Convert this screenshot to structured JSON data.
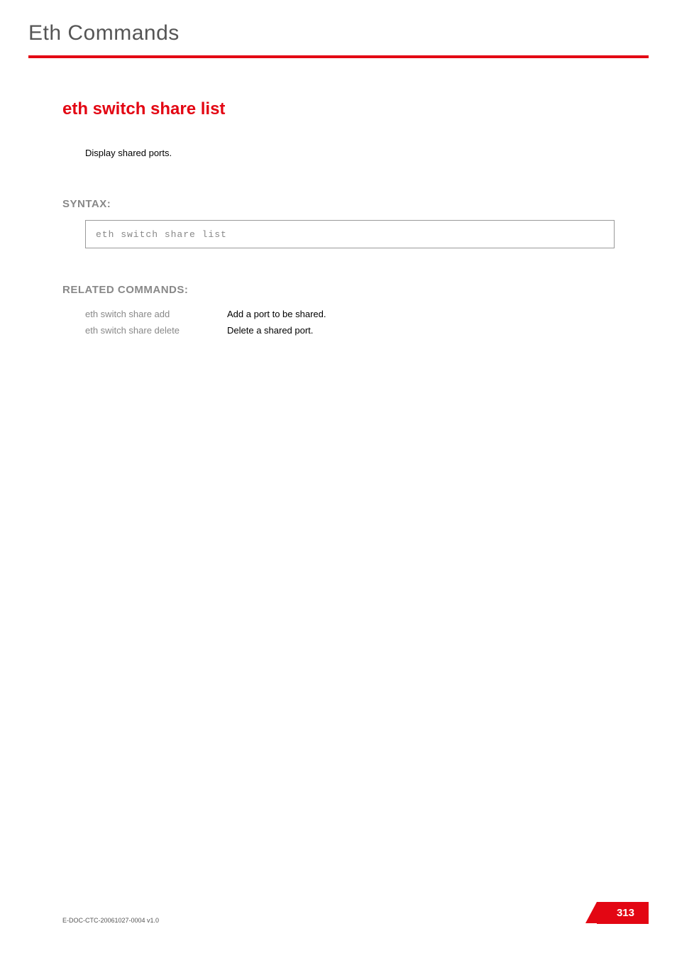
{
  "header": {
    "section_title": "Eth Commands"
  },
  "main": {
    "command_title": "eth switch share list",
    "description": "Display shared ports.",
    "syntax_heading": "SYNTAX:",
    "syntax_command": "eth switch share list",
    "related_heading": "RELATED COMMANDS:",
    "related": [
      {
        "link": "eth switch share add",
        "desc": "Add a port to be shared."
      },
      {
        "link": "eth switch share delete",
        "desc": "Delete a shared port."
      }
    ]
  },
  "footer": {
    "doc_id": "E-DOC-CTC-20061027-0004 v1.0",
    "page_number": "313"
  }
}
